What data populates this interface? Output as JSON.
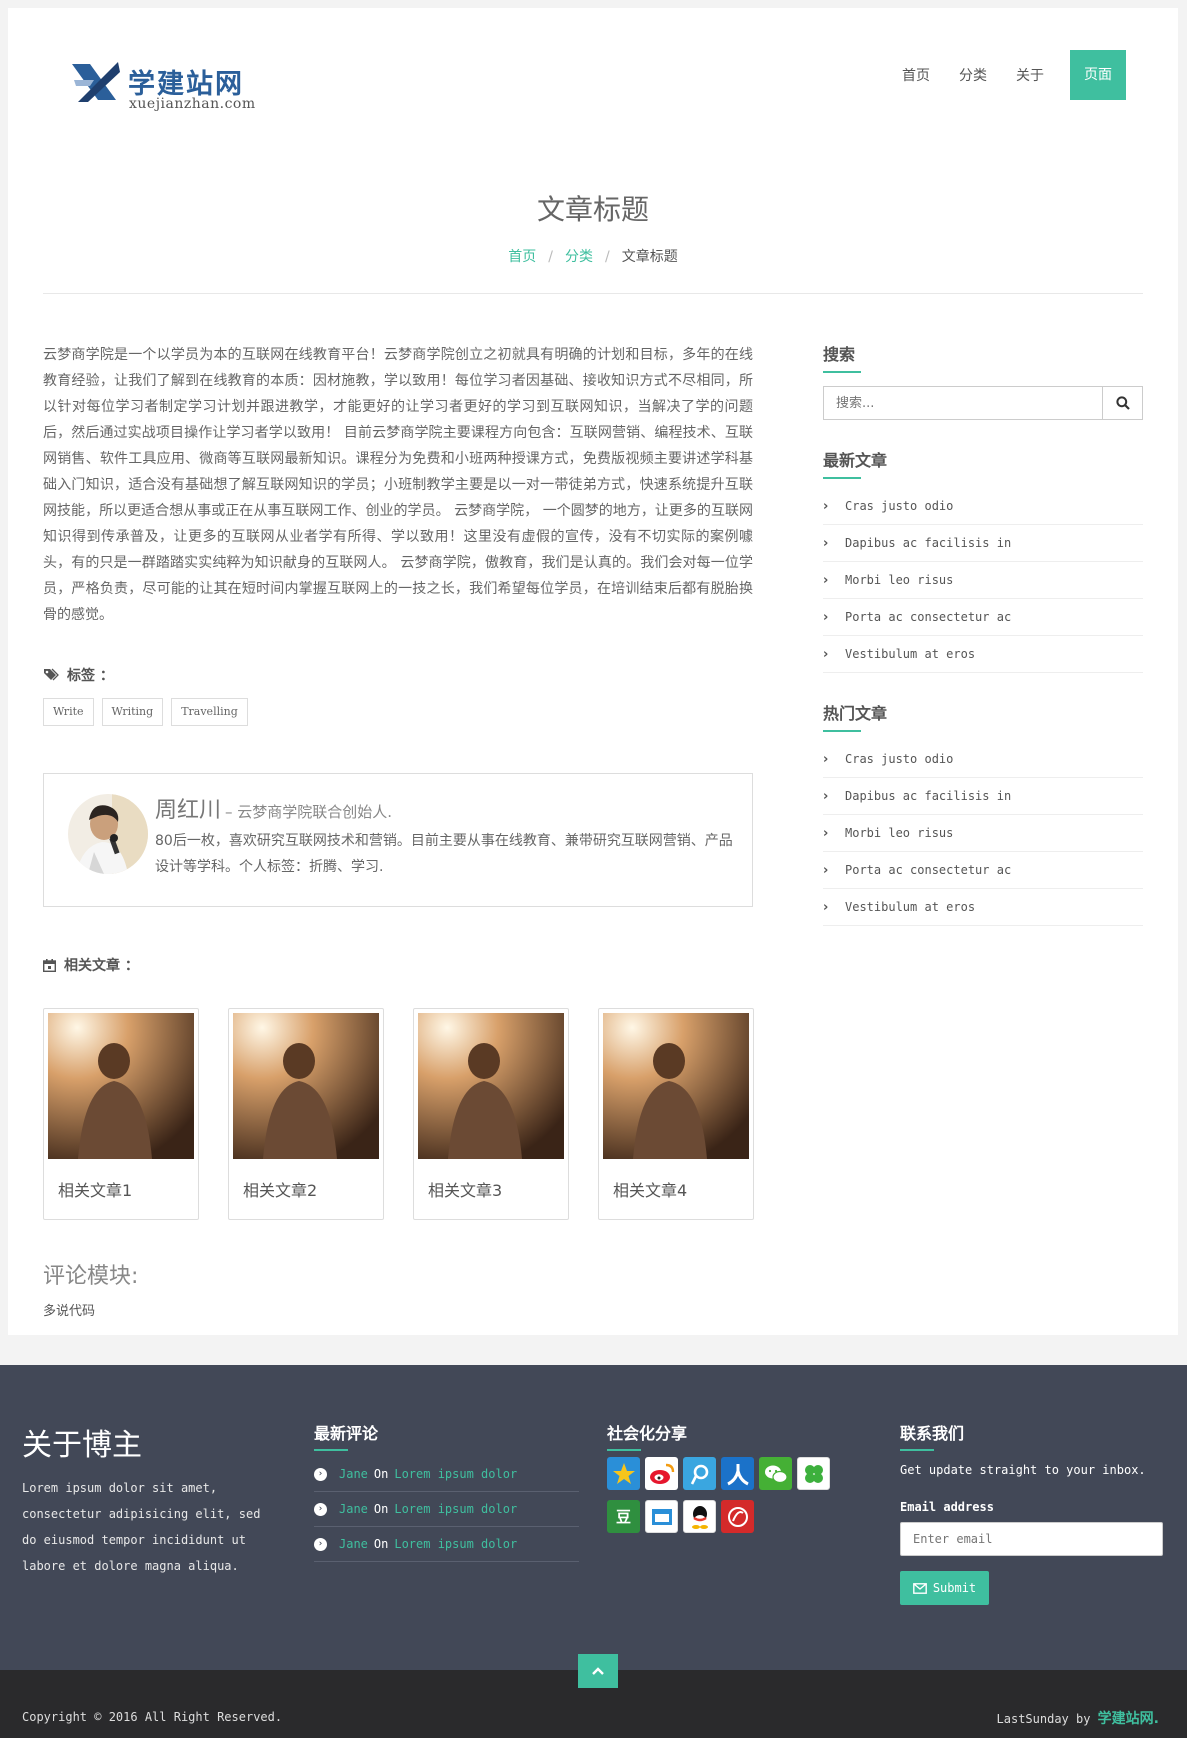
{
  "header": {
    "logo_title": "学建站网",
    "logo_sub": "xuejianzhan.com",
    "nav": [
      "首页",
      "分类",
      "关于",
      "页面"
    ]
  },
  "page": {
    "title": "文章标题",
    "breadcrumb": [
      "首页",
      "分类",
      "文章标题"
    ]
  },
  "article": {
    "body": "云梦商学院是一个以学员为本的互联网在线教育平台！云梦商学院创立之初就具有明确的计划和目标，多年的在线教育经验，让我们了解到在线教育的本质：因材施教，学以致用！每位学习者因基础、接收知识方式不尽相同，所以针对每位学习者制定学习计划并跟进教学，才能更好的让学习者更好的学习到互联网知识，当解决了学的问题后，然后通过实战项目操作让学习者学以致用！ 目前云梦商学院主要课程方向包含：互联网营销、编程技术、互联网销售、软件工具应用、微商等互联网最新知识。课程分为免费和小班两种授课方式，免费版视频主要讲述学科基础入门知识，适合没有基础想了解互联网知识的学员；小班制教学主要是以一对一带徒弟方式，快速系统提升互联网技能，所以更适合想从事或正在从事互联网工作、创业的学员。 云梦商学院， 一个圆梦的地方，让更多的互联网知识得到传承普及，让更多的互联网从业者学有所得、学以致用！这里没有虚假的宣传，没有不切实际的案例噱头，有的只是一群踏踏实实纯粹为知识献身的互联网人。 云梦商学院，傲教育，我们是认真的。我们会对每一位学员，严格负责，尽可能的让其在短时间内掌握互联网上的一技之长，我们希望每位学员，在培训结束后都有脱胎换骨的感觉。",
    "tags_label": "标签 ：",
    "tags": [
      "Write",
      "Writing",
      "Travelling"
    ],
    "author_name": "周红川",
    "author_role": "– 云梦商学院联合创始人.",
    "author_bio": "80后一枚，喜欢研究互联网技术和营销。目前主要从事在线教育、兼带研究互联网营销、产品设计等学科。个人标签：折腾、学习.",
    "related_label": "相关文章 ：",
    "related": [
      "相关文章1",
      "相关文章2",
      "相关文章3",
      "相关文章4"
    ],
    "comments_title": "评论模块:",
    "comments_code": "多说代码"
  },
  "sidebar": {
    "search_title": "搜索",
    "search_placeholder": "搜索...",
    "latest_title": "最新文章",
    "latest": [
      "Cras justo odio",
      "Dapibus ac facilisis in",
      "Morbi leo risus",
      "Porta ac consectetur ac",
      "Vestibulum at eros"
    ],
    "popular_title": "热门文章",
    "popular": [
      "Cras justo odio",
      "Dapibus ac facilisis in",
      "Morbi leo risus",
      "Porta ac consectetur ac",
      "Vestibulum at eros"
    ]
  },
  "footer": {
    "about_title": "关于博主",
    "about_text": "Lorem ipsum dolor sit amet, consectetur adipisicing elit, sed do eiusmod tempor incididunt ut labore et dolore magna aliqua.",
    "comments_title": "最新评论",
    "comments": [
      {
        "user": "Jane",
        "on": "On",
        "post": "Lorem ipsum dolor"
      },
      {
        "user": "Jane",
        "on": "On",
        "post": "Lorem ipsum dolor"
      },
      {
        "user": "Jane",
        "on": "On",
        "post": "Lorem ipsum dolor"
      }
    ],
    "share_title": "社会化分享",
    "share_icons": [
      "qzone-icon",
      "weibo-icon",
      "tencent-weibo-icon",
      "renren-icon",
      "wechat-icon",
      "kaixin-icon",
      "douban-icon",
      "pengyou-icon",
      "qq-icon",
      "netease-icon"
    ],
    "contact_title": "联系我们",
    "contact_text": "Get update straight to your inbox.",
    "email_label": "Email address",
    "email_placeholder": "Enter email",
    "submit_label": "Submit",
    "copyright": "Copyright © 2016 All Right Reserved.",
    "credit_prefix": "LastSunday by",
    "credit_brand": "学建站网."
  },
  "colors": {
    "accent": "#3fbf9f",
    "footer_bg": "#424857",
    "bottom_bg": "#2a2a2c",
    "logo_blue": "#2b5f9a"
  }
}
